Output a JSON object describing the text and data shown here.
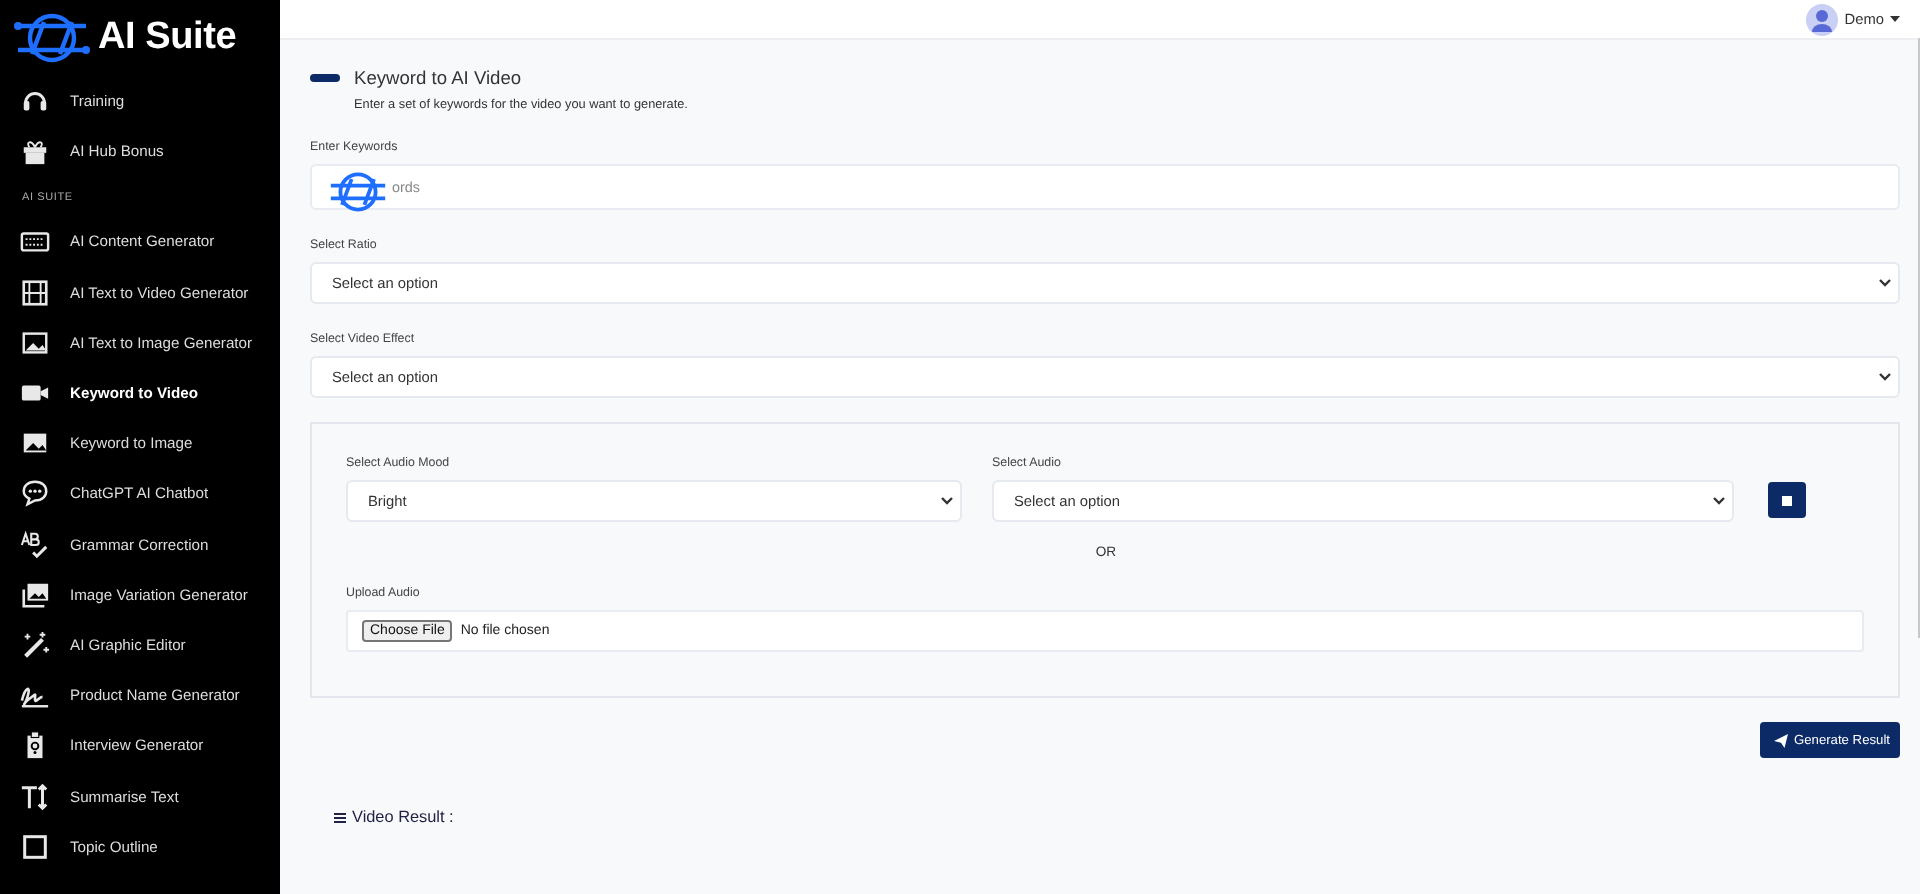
{
  "sidebar": {
    "brand": "AI Suite",
    "top_items": [
      {
        "label": "Training",
        "selected": false
      },
      {
        "label": "AI Hub Bonus",
        "selected": false
      }
    ],
    "section_label": "AI SUITE",
    "items": [
      {
        "label": "AI Content Generator",
        "selected": false
      },
      {
        "label": "AI Text to Video Generator",
        "selected": false
      },
      {
        "label": "AI Text to Image Generator",
        "selected": false
      },
      {
        "label": "Keyword to Video",
        "selected": true
      },
      {
        "label": "Keyword to Image",
        "selected": false
      },
      {
        "label": "ChatGPT AI Chatbot",
        "selected": false
      },
      {
        "label": "Grammar Correction",
        "selected": false
      },
      {
        "label": "Image Variation Generator",
        "selected": false
      },
      {
        "label": "AI Graphic Editor",
        "selected": false
      },
      {
        "label": "Product Name Generator",
        "selected": false
      },
      {
        "label": "Interview Generator",
        "selected": false
      },
      {
        "label": "Summarise Text",
        "selected": false
      },
      {
        "label": "Topic Outline",
        "selected": false
      }
    ]
  },
  "topbar": {
    "user": "Demo"
  },
  "form": {
    "title": "Keyword to AI Video",
    "subtitle": "Enter a set of keywords for the video you want to generate.",
    "keywords": {
      "label": "Enter Keywords",
      "placeholder": "ords"
    },
    "ratio": {
      "label": "Select Ratio",
      "value": "Select an option"
    },
    "effect": {
      "label": "Select Video Effect",
      "value": "Select an option"
    },
    "audio": {
      "mood": {
        "label": "Select Audio Mood",
        "value": "Bright"
      },
      "track": {
        "label": "Select Audio",
        "value": "Select an option"
      },
      "or": "OR",
      "upload": {
        "label": "Upload Audio",
        "button": "Choose File",
        "status": "No file chosen"
      }
    },
    "submit": "Generate Result",
    "result_heading": "Video Result :"
  }
}
